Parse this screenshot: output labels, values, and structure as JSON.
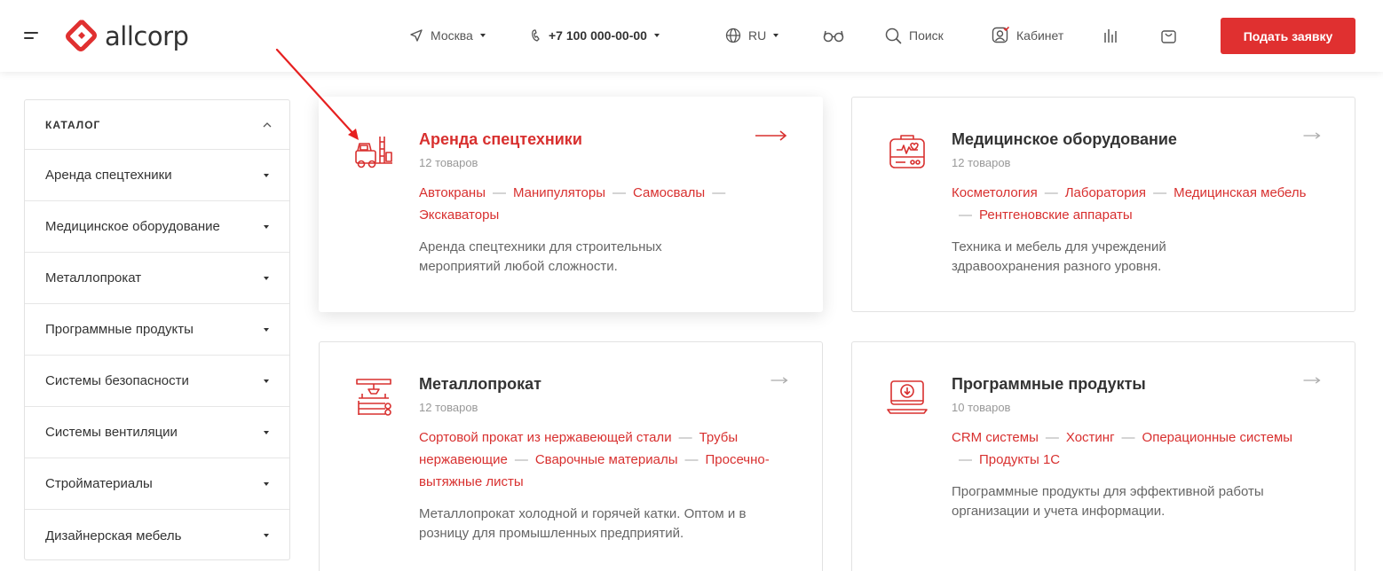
{
  "header": {
    "logo_text": "allcorp",
    "city": "Москва",
    "phone": "+7 100 000-00-00",
    "lang": "RU",
    "search_label": "Поиск",
    "cabinet_label": "Кабинет",
    "cta_label": "Подать заявку",
    "accent_color": "#e03030"
  },
  "sidebar": {
    "title": "КАТАЛОГ",
    "items": [
      {
        "label": "Аренда спецтехники"
      },
      {
        "label": "Медицинское оборудование"
      },
      {
        "label": "Металлопрокат"
      },
      {
        "label": "Программные продукты"
      },
      {
        "label": "Системы безопасности"
      },
      {
        "label": "Системы вентиляции"
      },
      {
        "label": "Стройматериалы"
      },
      {
        "label": "Дизайнерская мебель"
      }
    ]
  },
  "cards": [
    {
      "title": "Аренда спецтехники",
      "count": "12 товаров",
      "icon": "forklift-icon",
      "links": [
        "Автокраны",
        "Манипуляторы",
        "Самосвалы",
        "Экскаваторы"
      ],
      "desc": "Аренда спецтехники для строительных мероприятий любой сложности."
    },
    {
      "title": "Медицинское оборудование",
      "count": "12 товаров",
      "icon": "medical-device-icon",
      "links": [
        "Косметология",
        "Лаборатория",
        "Медицинская мебель",
        "Рентгеновские аппараты"
      ],
      "desc": "Техника и мебель для учреждений здравоохранения разного уровня."
    },
    {
      "title": "Металлопрокат",
      "count": "12 товаров",
      "icon": "metal-rolling-icon",
      "links": [
        "Сортовой прокат из нержавеющей стали",
        "Трубы нержавеющие",
        "Сварочные материалы",
        "Просечно-вытяжные листы"
      ],
      "desc": "Металлопрокат холодной и горячей катки. Оптом и в розницу для промышленных предприятий."
    },
    {
      "title": "Программные продукты",
      "count": "10 товаров",
      "icon": "laptop-download-icon",
      "links": [
        "CRM системы",
        "Хостинг",
        "Операционные системы",
        "Продукты 1С"
      ],
      "desc": "Программные продукты для эффективной работы организации и учета информации."
    }
  ]
}
